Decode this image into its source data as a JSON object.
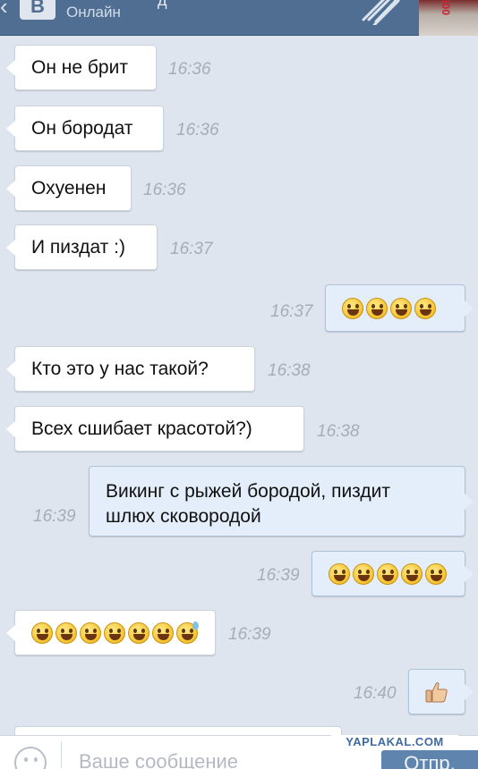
{
  "header": {
    "status": "Онлайн",
    "logo_letter": "В",
    "name_fragment": "д",
    "avatar_text": "500"
  },
  "messages": [
    {
      "dir": "in",
      "text": "Он не брит",
      "time": "16:36"
    },
    {
      "dir": "in",
      "text": "Он бородат",
      "time": "16:36"
    },
    {
      "dir": "in",
      "text": "Охуенен",
      "time": "16:36"
    },
    {
      "dir": "in",
      "text": "И пиздат :)",
      "time": "16:37"
    },
    {
      "dir": "out",
      "emoji_count": 4,
      "time": "16:37"
    },
    {
      "dir": "in",
      "text": "Кто это у нас такой?",
      "time": "16:38"
    },
    {
      "dir": "in",
      "text": "Всех сшибает красотой?)",
      "time": "16:38"
    },
    {
      "dir": "out",
      "text_line1": "Викинг с рыжей бородой, пиздит",
      "text_line2": "шлюх сковородой",
      "time": "16:39"
    },
    {
      "dir": "out",
      "emoji_count": 5,
      "time": "16:39"
    },
    {
      "dir": "in",
      "emoji_count": 7,
      "time": "16:39"
    },
    {
      "dir": "out",
      "icon": "thumbs-up-icon",
      "time": "16:40"
    }
  ],
  "input": {
    "placeholder": "Ваше сообщение",
    "send_label": "Отпр."
  },
  "watermark": "YAPLAKAL.COM",
  "colors": {
    "header_bg": "#4f6e91",
    "chat_bg": "#dfe5ee",
    "incoming_bubble": "#ffffff",
    "outgoing_bubble": "#e4eefa",
    "timestamp": "#a4adb8",
    "send_button": "#5f84ad"
  }
}
